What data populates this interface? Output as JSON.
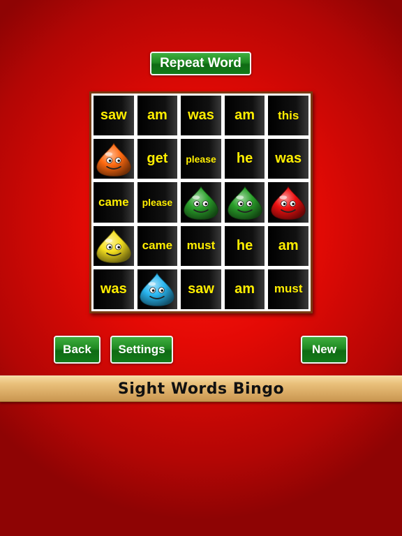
{
  "app": {
    "title": "Sight Words Bingo"
  },
  "toolbar": {
    "repeat_label": "Repeat Word",
    "back_label": "Back",
    "settings_label": "Settings",
    "new_label": "New"
  },
  "colors": {
    "button_green": "#1f8a22",
    "word_yellow": "#ffee00",
    "background_red": "#e40a05",
    "frame_brown": "#7a3a12"
  },
  "board": {
    "rows": [
      [
        {
          "type": "word",
          "text": "saw"
        },
        {
          "type": "word",
          "text": "am"
        },
        {
          "type": "word",
          "text": "was"
        },
        {
          "type": "word",
          "text": "am"
        },
        {
          "type": "word",
          "text": "this"
        }
      ],
      [
        {
          "type": "marker",
          "color": "#ff6a10",
          "name": "orange"
        },
        {
          "type": "word",
          "text": "get"
        },
        {
          "type": "word",
          "text": "please"
        },
        {
          "type": "word",
          "text": "he"
        },
        {
          "type": "word",
          "text": "was"
        }
      ],
      [
        {
          "type": "word",
          "text": "came"
        },
        {
          "type": "word",
          "text": "please"
        },
        {
          "type": "marker",
          "color": "#2aa02a",
          "name": "green"
        },
        {
          "type": "marker",
          "color": "#2aa02a",
          "name": "green"
        },
        {
          "type": "marker",
          "color": "#ee1010",
          "name": "red"
        }
      ],
      [
        {
          "type": "marker",
          "color": "#f5e020",
          "name": "yellow"
        },
        {
          "type": "word",
          "text": "came"
        },
        {
          "type": "word",
          "text": "must"
        },
        {
          "type": "word",
          "text": "he"
        },
        {
          "type": "word",
          "text": "am"
        }
      ],
      [
        {
          "type": "word",
          "text": "was"
        },
        {
          "type": "marker",
          "color": "#29b6f0",
          "name": "blue"
        },
        {
          "type": "word",
          "text": "saw"
        },
        {
          "type": "word",
          "text": "am"
        },
        {
          "type": "word",
          "text": "must"
        }
      ]
    ]
  }
}
